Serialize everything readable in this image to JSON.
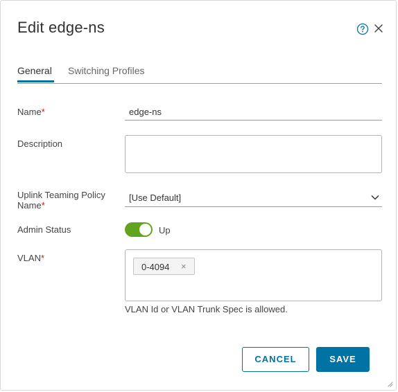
{
  "dialog": {
    "title": "Edit edge-ns"
  },
  "tabs": [
    {
      "label": "General",
      "active": true
    },
    {
      "label": "Switching Profiles",
      "active": false
    }
  ],
  "form": {
    "name": {
      "label": "Name",
      "required_mark": "*",
      "value": "edge-ns"
    },
    "description": {
      "label": "Description",
      "value": ""
    },
    "uplink": {
      "label_line1": "Uplink Teaming Policy",
      "label_line2": "Name",
      "required_mark": "*",
      "value": "[Use Default]"
    },
    "admin_status": {
      "label": "Admin Status",
      "state_text": "Up",
      "enabled": true
    },
    "vlan": {
      "label": "VLAN",
      "required_mark": "*",
      "chips": [
        {
          "text": "0-4094",
          "remove": "×"
        }
      ],
      "helper": "VLAN Id or VLAN Trunk Spec is allowed."
    }
  },
  "buttons": {
    "cancel": "CANCEL",
    "save": "SAVE"
  },
  "colors": {
    "accent": "#0072a3",
    "toggle_on": "#62a420",
    "required": "#c92100"
  },
  "icons": {
    "help": "help-icon",
    "close": "close-icon",
    "dropdown": "chevron-down-icon",
    "resize": "resize-handle-icon"
  }
}
